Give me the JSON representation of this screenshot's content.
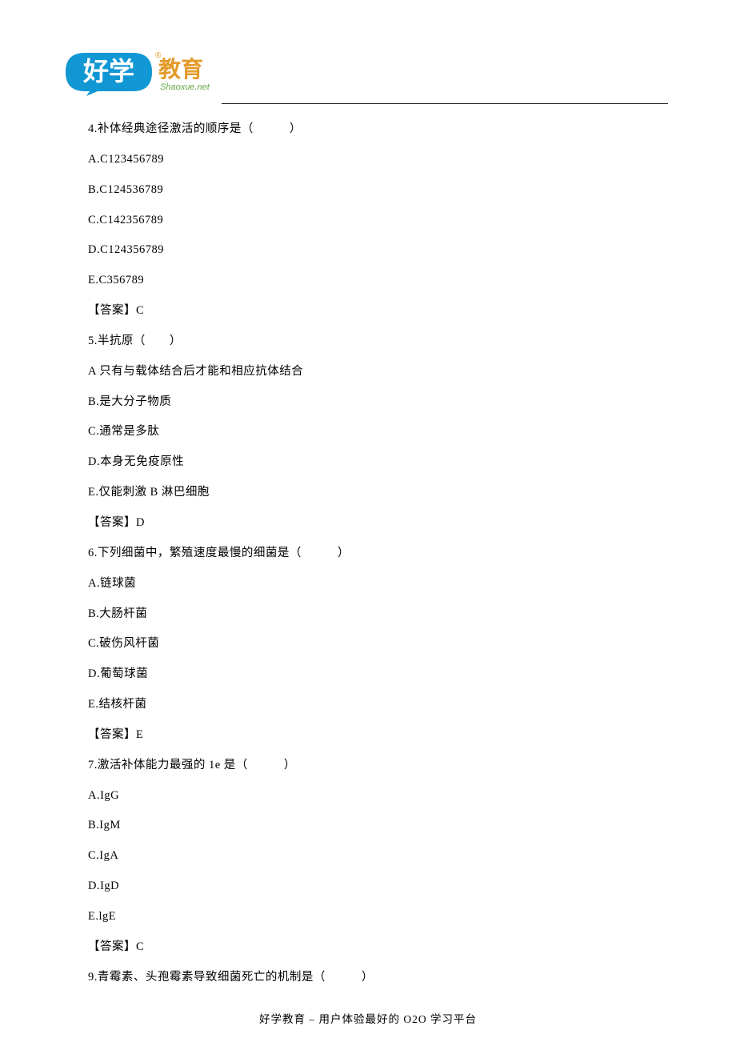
{
  "logo": {
    "brand_cn": "好学",
    "brand_suffix": "教育",
    "domain": "Shaoxue.net",
    "reg_mark": "®"
  },
  "lines": [
    "4.补体经典途径激活的顺序是（　　　）",
    "A.C123456789",
    "B.C124536789",
    "C.C142356789",
    "D.C124356789",
    "E.C356789",
    "【答案】C",
    "5.半抗原（　　）",
    "A 只有与载体结合后才能和相应抗体结合",
    "B.是大分子物质",
    "C.通常是多肽",
    "D.本身无免疫原性",
    "E.仅能刺激 B 淋巴细胞",
    "【答案】D",
    "6.下列细菌中，繁殖速度最慢的细菌是（　　　）",
    "A.链球菌",
    "B.大肠杆菌",
    "C.破伤风杆菌",
    "D.葡萄球菌",
    "E.结核杆菌",
    "【答案】E",
    "7.激活补体能力最强的 1e 是（　　　）",
    "A.IgG",
    "B.IgM",
    "C.IgA",
    "D.IgD",
    "E.lgE",
    "【答案】C",
    "9.青霉素、头孢霉素导致细菌死亡的机制是（　　　）"
  ],
  "footer": "好学教育  –  用户体验最好的 O2O 学习平台"
}
